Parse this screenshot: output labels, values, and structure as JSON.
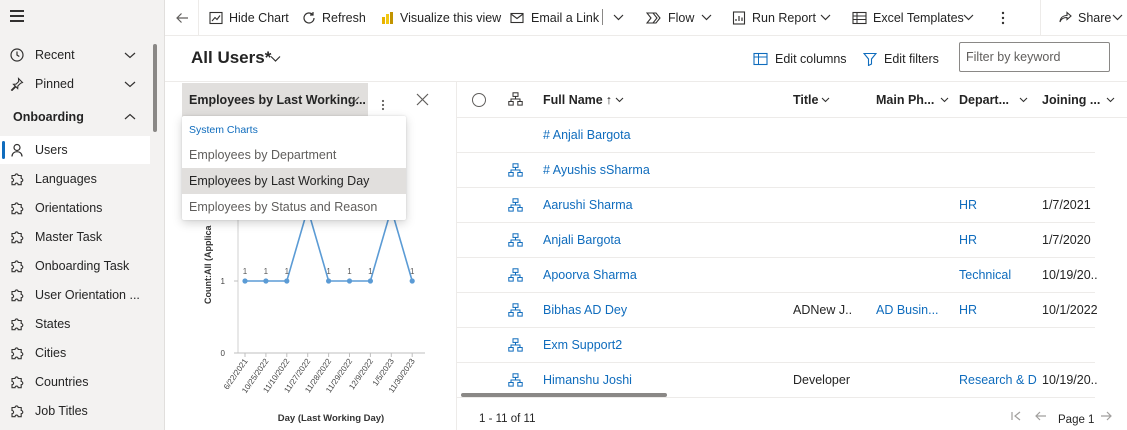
{
  "sidebar": {
    "items": [
      {
        "label": "Recent",
        "icon": "clock-icon",
        "chevron": true
      },
      {
        "label": "Pinned",
        "icon": "pin-icon",
        "chevron": true
      }
    ],
    "group": {
      "label": "Onboarding",
      "expanded": true
    },
    "entities": [
      {
        "label": "Users",
        "icon": "person-icon",
        "active": true
      },
      {
        "label": "Languages",
        "icon": "puzzle-icon"
      },
      {
        "label": "Orientations",
        "icon": "puzzle-icon"
      },
      {
        "label": "Master Task",
        "icon": "puzzle-icon"
      },
      {
        "label": "Onboarding Task",
        "icon": "puzzle-icon"
      },
      {
        "label": "User Orientation ...",
        "icon": "puzzle-icon"
      },
      {
        "label": "States",
        "icon": "puzzle-icon"
      },
      {
        "label": "Cities",
        "icon": "puzzle-icon"
      },
      {
        "label": "Countries",
        "icon": "puzzle-icon"
      },
      {
        "label": "Job Titles",
        "icon": "puzzle-icon"
      }
    ]
  },
  "toolbar": {
    "hide_chart": "Hide Chart",
    "refresh": "Refresh",
    "visualize": "Visualize this view",
    "email_link": "Email a Link",
    "flow": "Flow",
    "run_report": "Run Report",
    "excel_templates": "Excel Templates",
    "share": "Share"
  },
  "view": {
    "title": "All Users*",
    "edit_columns": "Edit columns",
    "edit_filters": "Edit filters",
    "filter_placeholder": "Filter by keyword"
  },
  "chart": {
    "selected": "Employees by Last Working...",
    "dropdown_heading": "System Charts",
    "options": [
      "Employees by Department",
      "Employees by Last Working Day",
      "Employees by Status and Reason"
    ],
    "selected_option_index": 1,
    "accent_color": "#5b9bd5"
  },
  "chart_data": {
    "type": "line",
    "xlabel": "Day (Last Working Day)",
    "ylabel": "Count:All (Applica",
    "y_ticks": [
      "0",
      "1"
    ],
    "categories": [
      "6/22/2021",
      "10/25/2022",
      "11/10/2022",
      "11/27/2022",
      "11/28/2022",
      "11/29/2022",
      "12/9/2022",
      "1/5/2023",
      "11/30/2023"
    ],
    "values": [
      1,
      1,
      1,
      2,
      1,
      1,
      1,
      2,
      1
    ],
    "data_labels": [
      "1",
      "1",
      "1",
      "",
      "1",
      "1",
      "1",
      "",
      "1"
    ]
  },
  "grid": {
    "columns": [
      "Full Name",
      "Title",
      "Main Ph...",
      "Depart...",
      "Joining ..."
    ],
    "sort_indicator": "↑",
    "rows": [
      {
        "name": "# Anjali Bargota",
        "title": "",
        "phone": "",
        "dept": "",
        "joining": "",
        "hier": false
      },
      {
        "name": "# Ayushis  sSharma",
        "title": "",
        "phone": "",
        "dept": "",
        "joining": "",
        "hier": true
      },
      {
        "name": "Aarushi Sharma",
        "title": "",
        "phone": "",
        "dept": "HR",
        "joining": "1/7/2021",
        "hier": true
      },
      {
        "name": "Anjali Bargota",
        "title": "",
        "phone": "",
        "dept": "HR",
        "joining": "1/7/2020",
        "hier": true
      },
      {
        "name": "Apoorva Sharma",
        "title": "",
        "phone": "",
        "dept": "Technical",
        "joining": "10/19/20...",
        "hier": true
      },
      {
        "name": "Bibhas AD Dey",
        "title": "ADNew J...",
        "phone": "AD Busin...",
        "dept": "HR",
        "joining": "10/1/2022",
        "hier": true
      },
      {
        "name": "Exm Support2",
        "title": "",
        "phone": "",
        "dept": "",
        "joining": "",
        "hier": true
      },
      {
        "name": "Himanshu Joshi",
        "title": "Developer",
        "phone": "",
        "dept": "Research & De",
        "joining": "10/19/20...",
        "hier": true
      }
    ],
    "record_count": "1 - 11 of 11",
    "page_label": "Page 1"
  }
}
